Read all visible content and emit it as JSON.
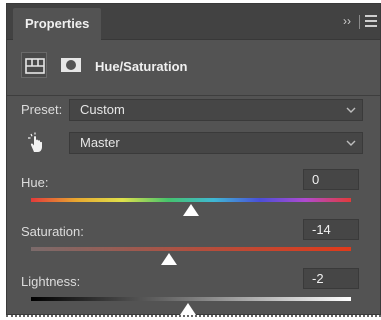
{
  "panel": {
    "tab_label": "Properties",
    "collapse_glyph": "››",
    "title": "Hue/Saturation"
  },
  "preset": {
    "label": "Preset:",
    "value": "Custom"
  },
  "channel": {
    "value": "Master"
  },
  "sliders": {
    "hue": {
      "label": "Hue:",
      "value": "0",
      "min": -180,
      "max": 180,
      "fraction": 0.5
    },
    "saturation": {
      "label": "Saturation:",
      "value": "-14",
      "min": -100,
      "max": 100,
      "fraction": 0.43
    },
    "lightness": {
      "label": "Lightness:",
      "value": "-2",
      "min": -100,
      "max": 100,
      "fraction": 0.49
    }
  },
  "icons": {
    "adjustment": "adjustment-layer-icon",
    "mask": "layer-mask-icon",
    "targeted_adjustment": "hand-pointer-icon",
    "menu": "panel-menu-icon"
  },
  "colors": {
    "panel_bg": "#535353",
    "titlebar_bg": "#424242",
    "field_bg": "#464646",
    "text": "#dcdcdc"
  }
}
